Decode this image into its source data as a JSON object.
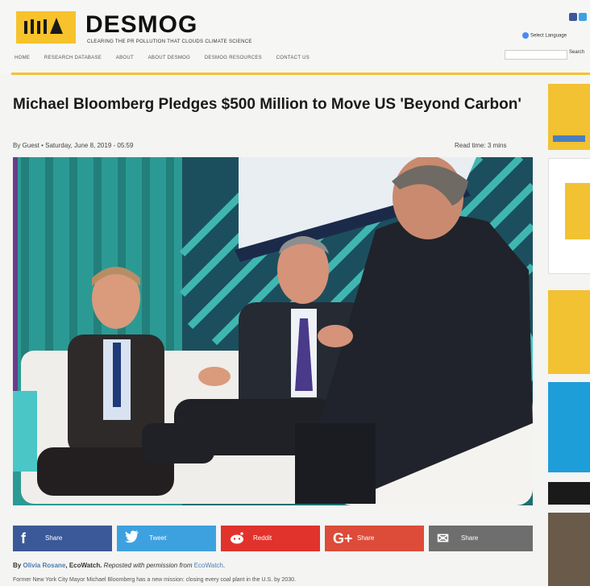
{
  "site": {
    "brand": "DESMOG",
    "tagline": "CLEARING THE PR POLLUTION THAT CLOUDS CLIMATE SCIENCE"
  },
  "nav": [
    "HOME",
    "RESEARCH DATABASE",
    "ABOUT",
    "ABOUT DESMOG",
    "DESMOG RESOURCES",
    "CONTACT US"
  ],
  "header_tools": {
    "language": "Select Language",
    "search_button": "Search"
  },
  "article": {
    "title": "Michael Bloomberg Pledges $500 Million to Move US 'Beyond Carbon'",
    "byline": "By Guest • Saturday, June 8, 2019 - 05:59",
    "read_time": "Read time: 3 mins",
    "credit_by": "By",
    "credit_author": "Olivia Rosane",
    "credit_org": ", EcoWatch.",
    "credit_note": " Reposted with permission from ",
    "credit_source": "EcoWatch",
    "credit_end": ".",
    "body_start": "Former New York City Mayor Michael Bloomberg has a new mission: closing every coal plant in the U.S. by 2030."
  },
  "share": [
    {
      "label": "Share",
      "icon": "f",
      "color": "#3b5998",
      "name": "facebook"
    },
    {
      "label": "Tweet",
      "icon": "t",
      "color": "#3da1e0",
      "name": "twitter"
    },
    {
      "label": "Reddit",
      "icon": "r",
      "color": "#e2322c",
      "name": "reddit"
    },
    {
      "label": "Share",
      "icon": "G+",
      "color": "#dd4b39",
      "name": "googleplus"
    },
    {
      "label": "Share",
      "icon": "✉",
      "color": "#6e6e6e",
      "name": "email"
    }
  ],
  "colors": {
    "accent": "#f2c233",
    "header_bg": "#f6f6f4"
  }
}
